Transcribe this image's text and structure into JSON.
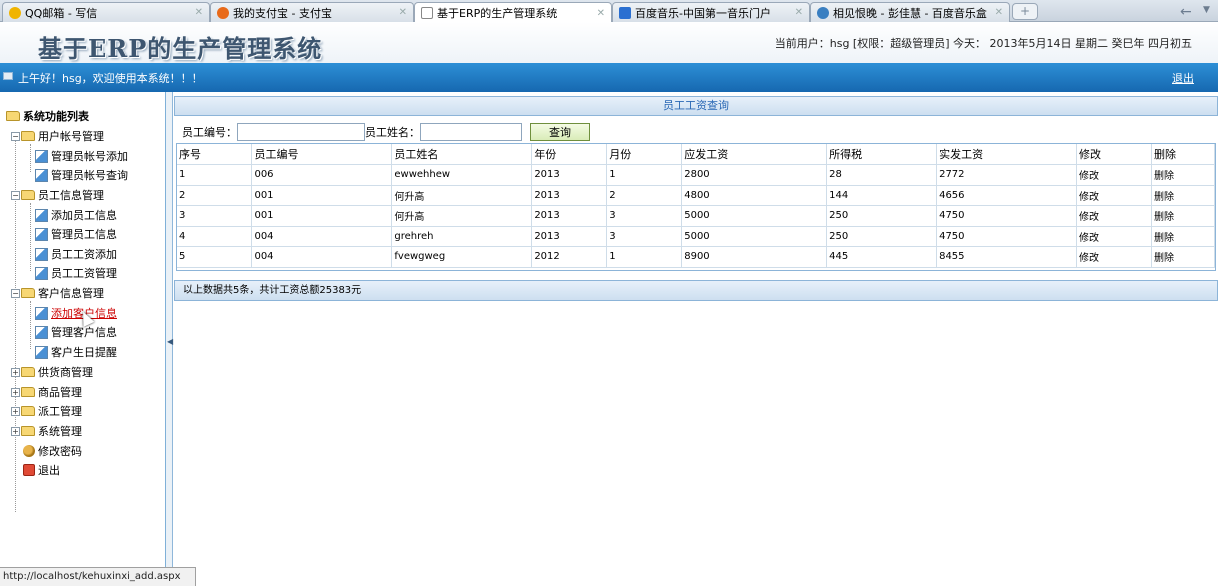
{
  "browser": {
    "tabs": [
      {
        "label": "QQ邮箱 - 写信",
        "icon": "qq-mail-icon",
        "color": "#f0b400"
      },
      {
        "label": "我的支付宝 - 支付宝",
        "icon": "alipay-icon",
        "color": "#e86a1a"
      },
      {
        "label": "基于ERP的生产管理系统",
        "icon": "page-icon",
        "color": "#ffffff"
      },
      {
        "label": "百度音乐-中国第一音乐门户",
        "icon": "baidu-music-icon",
        "color": "#2a6fd1"
      },
      {
        "label": "相见恨晚 - 彭佳慧 - 百度音乐盒",
        "icon": "headphone-icon",
        "color": "#3a7fc1"
      }
    ],
    "new_tab": "+",
    "back": "←",
    "status_url": "http://localhost/kehuxinxi_add.aspx"
  },
  "header": {
    "title": "基于ERP的生产管理系统",
    "user_info": "当前用户：hsg [权限：超级管理员] 今天： 2013年5月14日 星期二 癸巳年 四月初五"
  },
  "bar": {
    "greeting": "上午好！hsg，欢迎使用本系统！！！",
    "logout": "退出"
  },
  "sidebar": {
    "root": "系统功能列表",
    "groups": [
      {
        "label": "用户帐号管理",
        "items": [
          "管理员帐号添加",
          "管理员帐号查询"
        ]
      },
      {
        "label": "员工信息管理",
        "items": [
          "添加员工信息",
          "管理员工信息",
          "员工工资添加",
          "员工工资管理"
        ]
      },
      {
        "label": "客户信息管理",
        "items": [
          "添加客户信息",
          "管理客户信息",
          "客户生日提醒"
        ]
      },
      {
        "label": "供货商管理"
      },
      {
        "label": "商品管理"
      },
      {
        "label": "派工管理"
      },
      {
        "label": "系统管理"
      }
    ],
    "change_password": "修改密码",
    "exit": "退出"
  },
  "content": {
    "panel_title": "员工工资查询",
    "emp_no_label": "员工编号：",
    "emp_name_label": "员工姓名：",
    "emp_no_value": "",
    "emp_name_value": "",
    "query_button": "查询",
    "columns": [
      "序号",
      "员工编号",
      "员工姓名",
      "年份",
      "月份",
      "应发工资",
      "所得税",
      "实发工资",
      "修改",
      "删除"
    ],
    "rows": [
      [
        "1",
        "006",
        "ewwehhew",
        "2013",
        "1",
        "2800",
        "28",
        "2772",
        "修改",
        "删除"
      ],
      [
        "2",
        "001",
        "何升高",
        "2013",
        "2",
        "4800",
        "144",
        "4656",
        "修改",
        "删除"
      ],
      [
        "3",
        "001",
        "何升高",
        "2013",
        "3",
        "5000",
        "250",
        "4750",
        "修改",
        "删除"
      ],
      [
        "4",
        "004",
        "grehreh",
        "2013",
        "3",
        "5000",
        "250",
        "4750",
        "修改",
        "删除"
      ],
      [
        "5",
        "004",
        "fvewgweg",
        "2012",
        "1",
        "8900",
        "445",
        "8455",
        "修改",
        "删除"
      ]
    ],
    "summary": "以上数据共5条，共计工资总额25383元"
  }
}
